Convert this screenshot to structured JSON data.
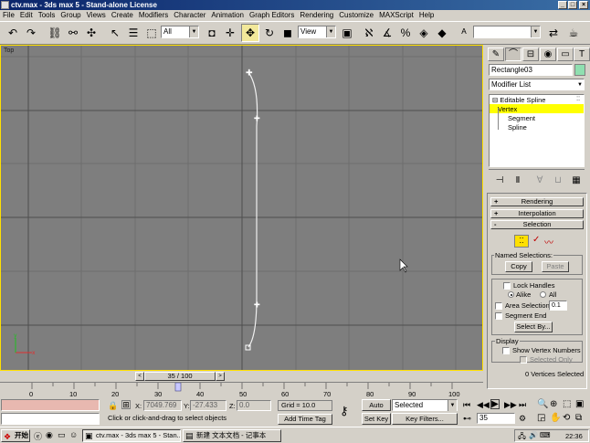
{
  "window": {
    "title": "ctv.max - 3ds max 5 - Stand-alone License"
  },
  "menu": [
    "File",
    "Edit",
    "Tools",
    "Group",
    "Views",
    "Create",
    "Modifiers",
    "Character",
    "Animation",
    "Graph Editors",
    "Rendering",
    "Customize",
    "MAXScript",
    "Help"
  ],
  "toolbar": {
    "selection_filter": "All",
    "ref_coord": "View"
  },
  "viewport": {
    "label": "Top"
  },
  "timeline": {
    "frame_counter": "35 / 100",
    "ticks": [
      "0",
      "10",
      "20",
      "30",
      "40",
      "50",
      "60",
      "70",
      "80",
      "90",
      "100"
    ]
  },
  "panel": {
    "object_name": "Rectangle03",
    "modifier_list": "Modifier List",
    "stack": [
      "Editable Spline",
      "Vertex",
      "Segment",
      "Spline"
    ],
    "rollouts": [
      "Rendering",
      "Interpolation",
      "Selection"
    ],
    "named_selections": "Named Selections:",
    "copy": "Copy",
    "paste": "Paste",
    "lock_handles": "Lock Handles",
    "alike": "Alike",
    "all": "All",
    "area_selection": "Area Selection:",
    "area_value": "0.1",
    "segment_end": "Segment End",
    "select_by": "Select By...",
    "display": "Display",
    "show_vertex_numbers": "Show Vertex Numbers",
    "selected_only": "Selected Only",
    "vertices_selected": "0 Vertices Selected"
  },
  "status": {
    "x_label": "X:",
    "x_value": "7049.769",
    "y_label": "Y:",
    "y_value": "-27.433",
    "z_label": "Z:",
    "z_value": "0.0",
    "grid": "Grid = 10.0",
    "prompt": "Click or click-and-drag to select objects",
    "add_time_tag": "Add Time Tag",
    "auto_key": "Auto Key",
    "set_key": "Set Key",
    "key_mode": "Selected",
    "key_filters": "Key Filters...",
    "current_frame": "35"
  },
  "taskbar": {
    "start": "开始",
    "task1": "ctv.max - 3ds max 5 - Stan...",
    "task2": "新建 文本文档 - 记事本",
    "clock": "22:36"
  },
  "colors": {
    "viewport_bg": "#7e7e7e",
    "active_border": "#ffe000",
    "highlight": "#ffff00",
    "title_bar": "#0a246a"
  }
}
